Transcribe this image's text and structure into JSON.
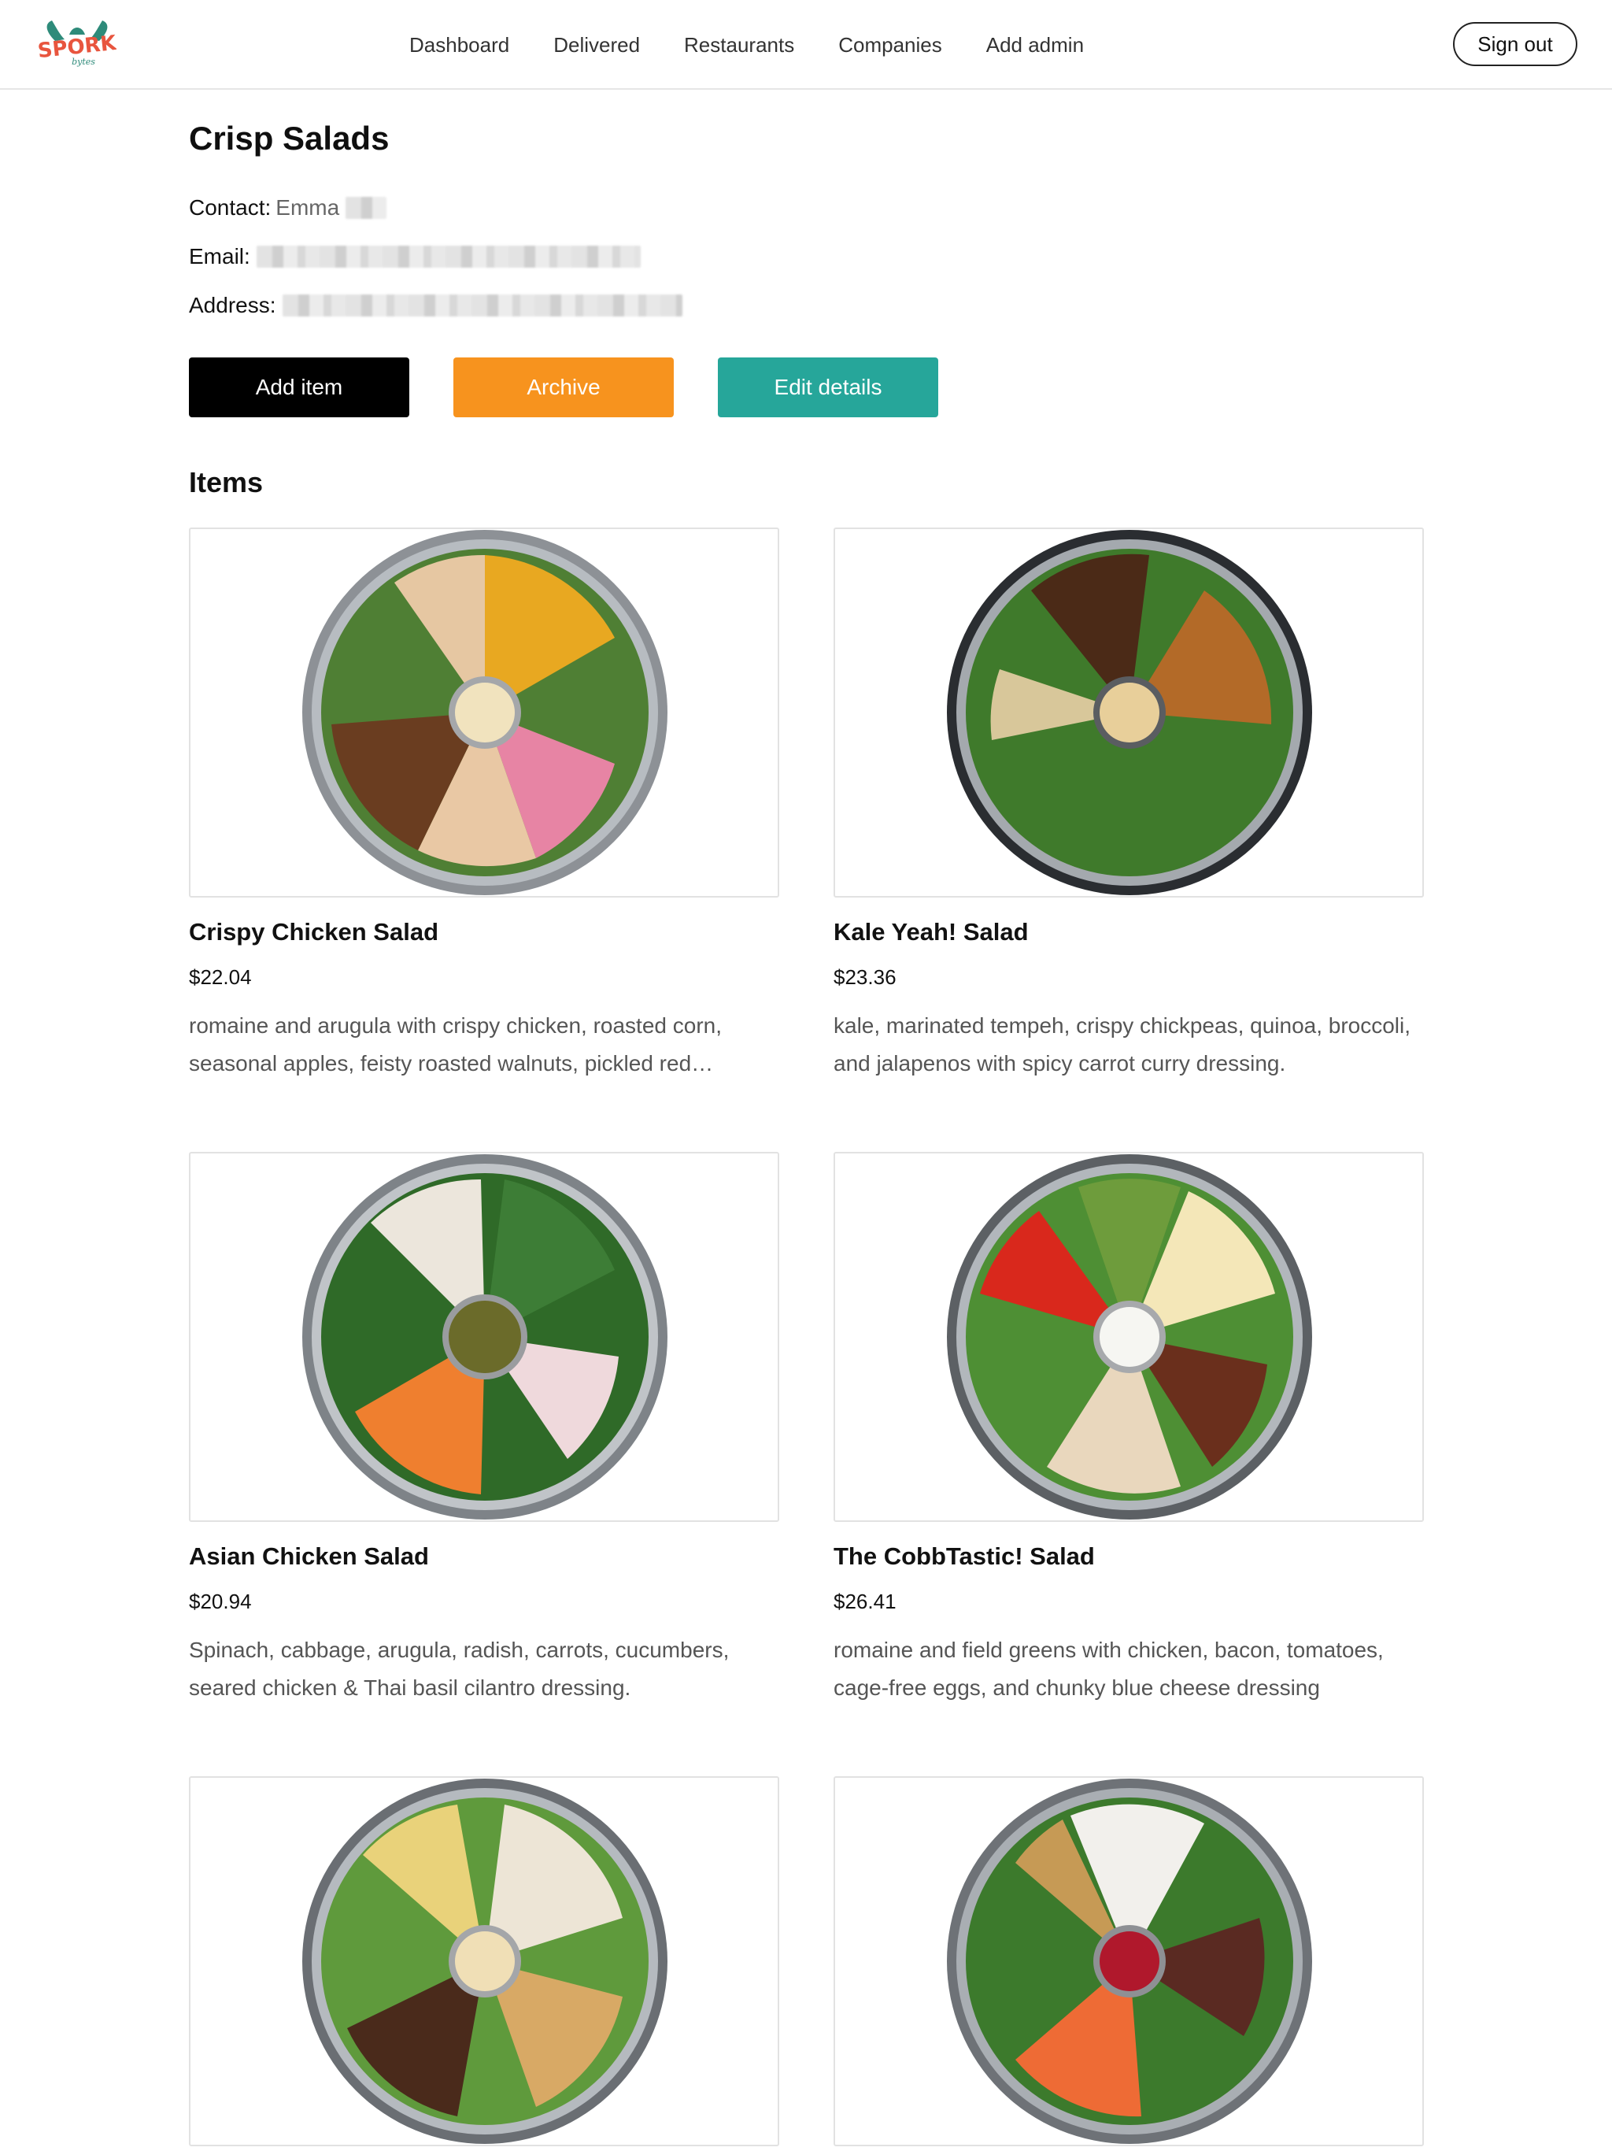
{
  "brand": {
    "logo_text": "SPORK",
    "logo_sub": "bytes"
  },
  "nav": {
    "items": [
      {
        "label": "Dashboard"
      },
      {
        "label": "Delivered"
      },
      {
        "label": "Restaurants"
      },
      {
        "label": "Companies"
      },
      {
        "label": "Add admin"
      }
    ],
    "sign_out": "Sign out"
  },
  "restaurant": {
    "name": "Crisp Salads",
    "contact_label": "Contact:",
    "contact_value": "Emma",
    "email_label": "Email:",
    "address_label": "Address:"
  },
  "actions": {
    "add_item": "Add item",
    "archive": "Archive",
    "edit_details": "Edit details"
  },
  "colors": {
    "archive": "#f7931e",
    "edit": "#26a69a",
    "add": "#000000"
  },
  "items_heading": "Items",
  "items": [
    {
      "name": "Crispy Chicken Salad",
      "price": "$22.04",
      "description": "romaine and arugula with crispy chicken, roasted corn, seasonal apples, feisty roasted walnuts, pickled red…"
    },
    {
      "name": "Kale Yeah! Salad",
      "price": "$23.36",
      "description": "kale, marinated tempeh, crispy chickpeas, quinoa, broccoli, and jalapenos with spicy carrot curry dressing."
    },
    {
      "name": "Asian Chicken Salad",
      "price": "$20.94",
      "description": "Spinach, cabbage, arugula, radish, carrots, cucumbers, seared chicken & Thai basil cilantro dressing."
    },
    {
      "name": "The CobbTastic! Salad",
      "price": "$26.41",
      "description": "romaine and field greens with chicken, bacon, tomatoes, cage-free eggs, and chunky blue cheese dressing"
    },
    {
      "name": "",
      "price": "",
      "description": ""
    },
    {
      "name": "",
      "price": "",
      "description": ""
    }
  ]
}
